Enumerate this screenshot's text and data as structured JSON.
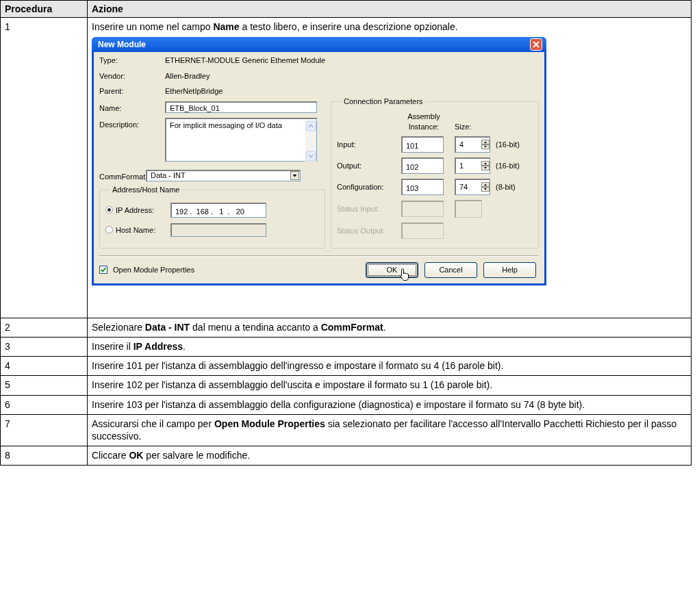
{
  "table": {
    "columns": [
      "Procedura",
      "Azione"
    ],
    "rows": [
      {
        "step": "1",
        "text": "Inserire un nome nel campo **Name** a testo libero, e inserire una descrizione opzionale.",
        "dialog": {
          "title": "New Module",
          "info": [
            {
              "label": "Type:",
              "value": "ETHERNET-MODULE Generic Ethemet Module"
            },
            {
              "label": "Vendor:",
              "value": "Allen-Bradley"
            },
            {
              "label": "Parent:",
              "value": "EtherNetIpBridge"
            }
          ],
          "name": {
            "label": "Name:",
            "value": "ETB_Block_01"
          },
          "description": {
            "label": "Description:",
            "value": "For implicit messaging of I/O data"
          },
          "comm_format": {
            "label": "CommFormat:",
            "value": "Data - INT"
          },
          "address": {
            "title": "Address/Host Name",
            "options": [
              {
                "label": "IP Address:",
                "selected": true,
                "value": "192 .  168 .   1  .   20"
              },
              {
                "label": "Host Name:",
                "selected": false
              }
            ]
          },
          "connection": {
            "title": "Connection Parameters",
            "instance_header": "Assembly Instance:",
            "size_header": "Size:",
            "rows": [
              {
                "label": "Input:",
                "disabled": false,
                "kind": "spinner",
                "instance": "101",
                "size": "4",
                "unit": "(16-bit)"
              },
              {
                "label": "Output:",
                "disabled": false,
                "kind": "spinner",
                "instance": "102",
                "size": "1",
                "unit": "(16-bit)"
              },
              {
                "label": "Configuration:",
                "disabled": false,
                "kind": "spinner",
                "instance": "103",
                "size": "74",
                "unit": "(8-bit)"
              },
              {
                "label": "Status Input:",
                "disabled": true,
                "kind": "box"
              },
              {
                "label": "Status Output:",
                "disabled": true,
                "kind": "none"
              }
            ]
          },
          "open_properties": {
            "label": "Open Module Properties",
            "checked": true
          },
          "buttons": [
            {
              "label": "OK",
              "default": true
            },
            {
              "label": "Cancel",
              "default": false
            },
            {
              "label": "Help",
              "default": false
            }
          ]
        }
      },
      {
        "step": "2",
        "text": "Selezionare **Data - INT** dal menu a tendina accanto a **CommFormat**."
      },
      {
        "step": "3",
        "text": "Inserire il **IP Address**."
      },
      {
        "step": "4",
        "text": "Inserire 101 per l'istanza di assemblaggio dell'ingresso e impostare il formato su 4 (16 parole bit)."
      },
      {
        "step": "5",
        "text": "Inserire 102 per l'istanza di assemblaggio dell'uscita e impostare il formato su 1 (16 parole bit)."
      },
      {
        "step": "6",
        "text": "Inserire 103 per l'istanza di assemblaggio della configurazione (diagnostica) e impostare il formato su 74 (8 byte bit)."
      },
      {
        "step": "7",
        "text": "Assicurarsi che il campo per **Open Module Properties** sia selezionato per facilitare l'accesso all'Intervallo Pacchetti Richiesto per il passo successivo."
      },
      {
        "step": "8",
        "text": "Cliccare **OK** per salvare le modifiche."
      }
    ]
  }
}
